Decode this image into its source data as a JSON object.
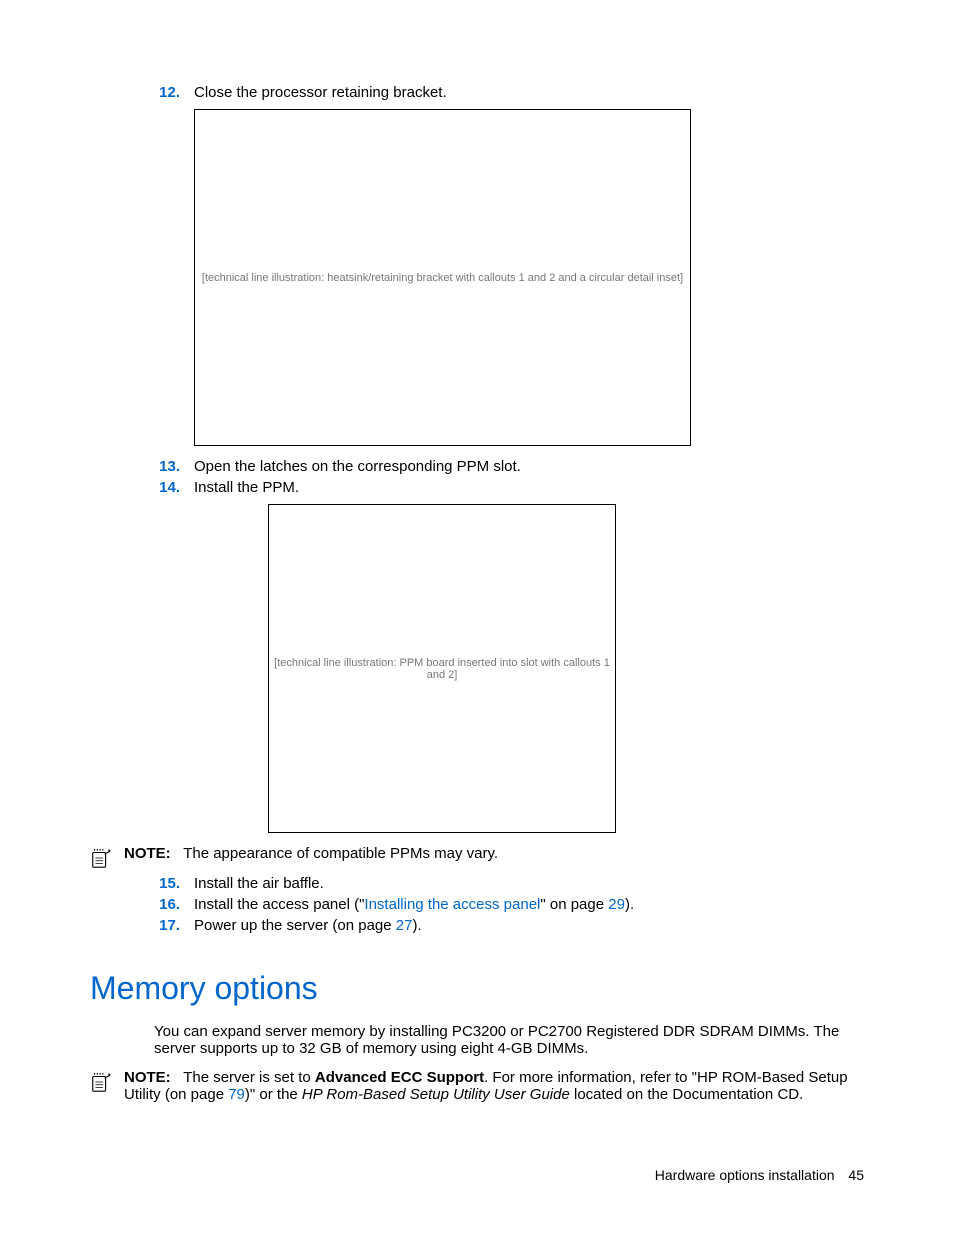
{
  "steps": {
    "s12": {
      "num": "12.",
      "text": "Close the processor retaining bracket."
    },
    "s13": {
      "num": "13.",
      "text": "Open the latches on the corresponding PPM slot."
    },
    "s14": {
      "num": "14.",
      "text": "Install the PPM."
    },
    "s15": {
      "num": "15.",
      "text": "Install the air baffle."
    },
    "s16": {
      "num": "16.",
      "text_a": "Install the access panel (\"",
      "link": "Installing the access panel",
      "text_b": "\" on page ",
      "page": "29",
      "text_c": ")."
    },
    "s17": {
      "num": "17.",
      "text_a": "Power up the server (on page ",
      "page": "27",
      "text_b": ")."
    }
  },
  "figures": {
    "fig1": "[technical line illustration: heatsink/retaining bracket with callouts 1 and 2 and a circular detail inset]",
    "fig2": "[technical line illustration: PPM board inserted into slot with callouts 1 and 2]"
  },
  "notes": {
    "note1": {
      "label": "NOTE:",
      "text": "The appearance of compatible PPMs may vary."
    },
    "note2": {
      "label": "NOTE:",
      "text_a": "The server is set to ",
      "bold": "Advanced ECC Support",
      "text_b": ". For more information, refer to \"HP ROM-Based Setup Utility (on page ",
      "page": "79",
      "text_c": ")\" or the ",
      "italic": "HP Rom-Based Setup Utility User Guide",
      "text_d": " located on the Documentation CD."
    }
  },
  "heading": "Memory options",
  "body": {
    "p1": "You can expand server memory by installing PC3200 or PC2700 Registered DDR SDRAM DIMMs. The server supports up to 32 GB of memory using eight 4-GB DIMMs."
  },
  "footer": {
    "section": "Hardware options installation",
    "page": "45"
  }
}
